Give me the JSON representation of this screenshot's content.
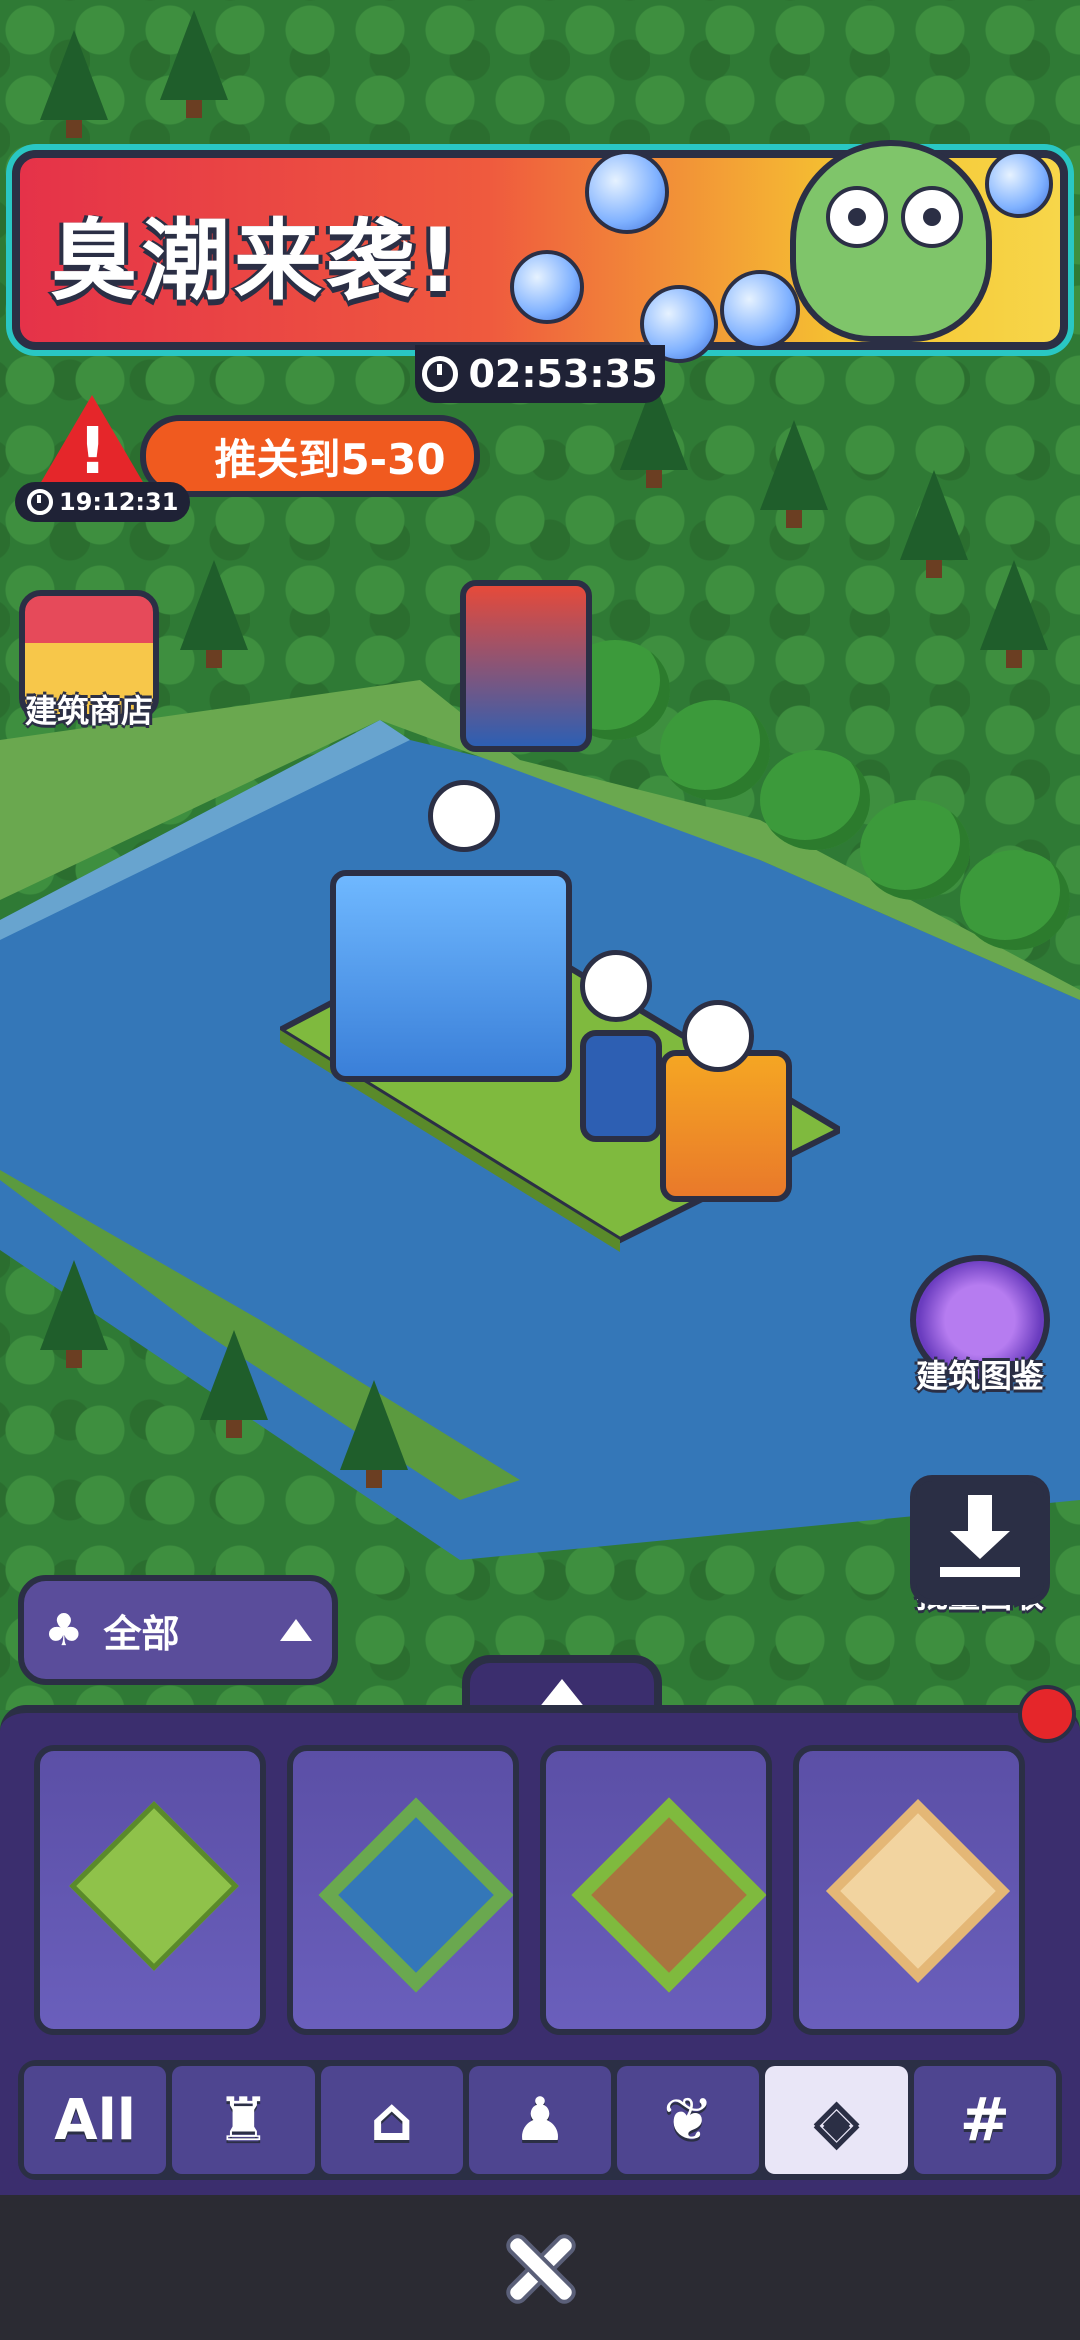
{
  "event": {
    "title": "臭潮来袭!",
    "timer": "02:53:35"
  },
  "quest": {
    "label": "推关到5-30",
    "timer": "19:12:31",
    "warn_mark": "!"
  },
  "side_buttons": {
    "shop_label": "建筑商店",
    "codex_label": "建筑图鉴",
    "recycle_label": "批量回收"
  },
  "filter": {
    "label": "全部"
  },
  "tiles": [
    {
      "name": "grass-tile"
    },
    {
      "name": "pond-tile"
    },
    {
      "name": "dirt-tile"
    },
    {
      "name": "sand-tile"
    }
  ],
  "categories": {
    "all_label": "All",
    "active_index": 5
  },
  "colors": {
    "water": "#3477b8",
    "panel": "#3b2e6e",
    "accent": "#f05a1f"
  }
}
